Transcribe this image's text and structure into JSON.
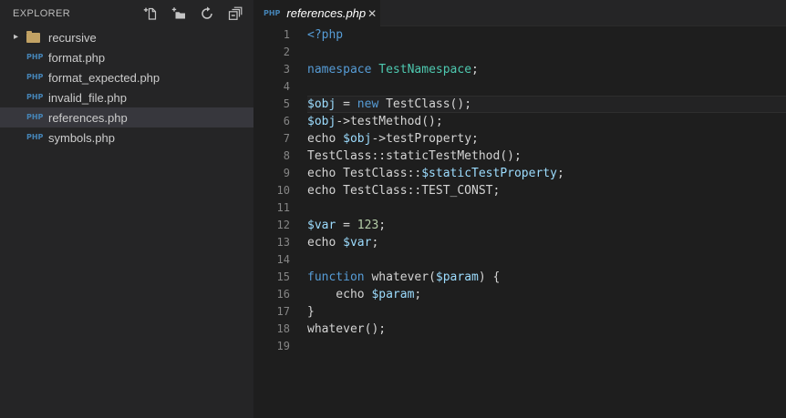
{
  "colors": {
    "keyword": "#569CD6",
    "type": "#4EC9B0",
    "variable": "#9CDCFE",
    "number": "#B5CEA8",
    "default": "#D4D4D4"
  },
  "sidebar": {
    "title": "EXPLORER",
    "chevron_glyph": "▸",
    "file_icon_label": "PHP",
    "actions": [
      "new-file",
      "new-folder",
      "refresh",
      "collapse-all"
    ],
    "items": [
      {
        "label": "recursive",
        "type": "folder",
        "selected": false
      },
      {
        "label": "format.php",
        "type": "php",
        "selected": false
      },
      {
        "label": "format_expected.php",
        "type": "php",
        "selected": false
      },
      {
        "label": "invalid_file.php",
        "type": "php",
        "selected": false
      },
      {
        "label": "references.php",
        "type": "php",
        "selected": true
      },
      {
        "label": "symbols.php",
        "type": "php",
        "selected": false
      }
    ]
  },
  "tab": {
    "label": "references.php",
    "icon_label": "PHP",
    "close_glyph": "✕"
  },
  "editor": {
    "active_line": 5,
    "lines": [
      {
        "n": 1,
        "tokens": [
          [
            "<?php",
            "keyword"
          ]
        ]
      },
      {
        "n": 2,
        "tokens": []
      },
      {
        "n": 3,
        "tokens": [
          [
            "namespace",
            "keyword"
          ],
          [
            " ",
            "default"
          ],
          [
            "TestNamespace",
            "type"
          ],
          [
            ";",
            "default"
          ]
        ]
      },
      {
        "n": 4,
        "tokens": []
      },
      {
        "n": 5,
        "tokens": [
          [
            "$obj",
            "variable"
          ],
          [
            " = ",
            "default"
          ],
          [
            "new",
            "keyword"
          ],
          [
            " TestClass();",
            "default"
          ]
        ]
      },
      {
        "n": 6,
        "tokens": [
          [
            "$obj",
            "variable"
          ],
          [
            "->testMethod();",
            "default"
          ]
        ]
      },
      {
        "n": 7,
        "tokens": [
          [
            "echo ",
            "default"
          ],
          [
            "$obj",
            "variable"
          ],
          [
            "->testProperty;",
            "default"
          ]
        ]
      },
      {
        "n": 8,
        "tokens": [
          [
            "TestClass::staticTestMethod();",
            "default"
          ]
        ]
      },
      {
        "n": 9,
        "tokens": [
          [
            "echo TestClass::",
            "default"
          ],
          [
            "$staticTestProperty",
            "variable"
          ],
          [
            ";",
            "default"
          ]
        ]
      },
      {
        "n": 10,
        "tokens": [
          [
            "echo TestClass::TEST_CONST;",
            "default"
          ]
        ]
      },
      {
        "n": 11,
        "tokens": []
      },
      {
        "n": 12,
        "tokens": [
          [
            "$var",
            "variable"
          ],
          [
            " = ",
            "default"
          ],
          [
            "123",
            "number"
          ],
          [
            ";",
            "default"
          ]
        ]
      },
      {
        "n": 13,
        "tokens": [
          [
            "echo ",
            "default"
          ],
          [
            "$var",
            "variable"
          ],
          [
            ";",
            "default"
          ]
        ]
      },
      {
        "n": 14,
        "tokens": []
      },
      {
        "n": 15,
        "tokens": [
          [
            "function",
            "keyword"
          ],
          [
            " whatever(",
            "default"
          ],
          [
            "$param",
            "variable"
          ],
          [
            ") {",
            "default"
          ]
        ]
      },
      {
        "n": 16,
        "tokens": [
          [
            "    echo ",
            "default"
          ],
          [
            "$param",
            "variable"
          ],
          [
            ";",
            "default"
          ]
        ]
      },
      {
        "n": 17,
        "tokens": [
          [
            "}",
            "default"
          ]
        ]
      },
      {
        "n": 18,
        "tokens": [
          [
            "whatever();",
            "default"
          ]
        ]
      },
      {
        "n": 19,
        "tokens": []
      }
    ]
  }
}
